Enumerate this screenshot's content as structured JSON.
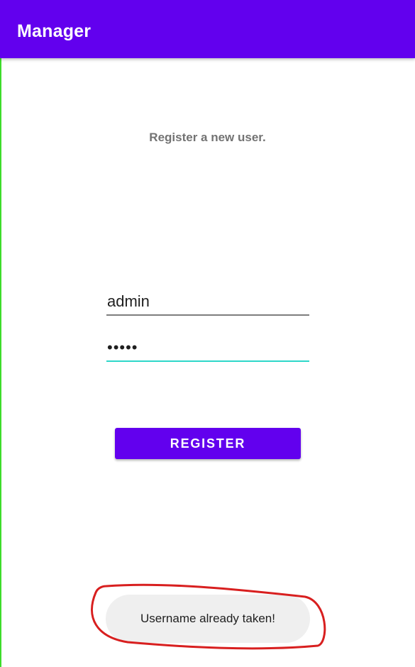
{
  "app_bar": {
    "title": "Manager"
  },
  "form": {
    "subtitle": "Register a new user.",
    "username": {
      "value": "admin"
    },
    "password": {
      "masked_value": "•••••",
      "focused": true
    },
    "register_label": "REGISTER"
  },
  "toast": {
    "message": "Username already taken!"
  },
  "colors": {
    "primary": "#6200ee",
    "focus_underline": "#2ed7c9",
    "annotation": "#d81f1f"
  }
}
